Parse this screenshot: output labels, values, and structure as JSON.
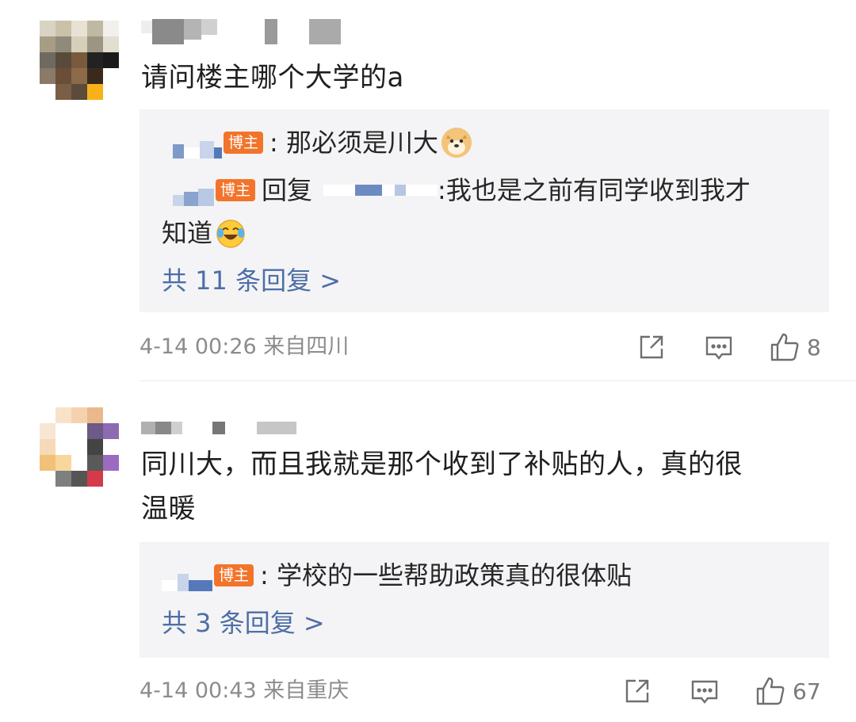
{
  "comments": [
    {
      "text": "请问楼主哪个大学的a",
      "replies": [
        {
          "badge": "博主",
          "text": ": 那必须是川大",
          "emoji": "doge-emoji"
        },
        {
          "badge": "博主",
          "prefix": "回复",
          "text_line1": ":我也是之前有同学收到我才",
          "text_line2": "知道",
          "emoji": "laugh-cry-emoji"
        }
      ],
      "more_replies": "共 11 条回复 >",
      "timestamp": "4-14 00:26 来自四川",
      "likes": "8"
    },
    {
      "text_line1": "同川大，而且我就是那个收到了补贴的人，真的很",
      "text_line2": "温暖",
      "replies": [
        {
          "badge": "博主",
          "text": ": 学校的一些帮助政策真的很体贴"
        }
      ],
      "more_replies": "共 3 条回复 >",
      "timestamp": "4-14 00:43 来自重庆",
      "likes": "67"
    }
  ],
  "icons": {
    "share": "share-icon",
    "comment": "comment-icon",
    "like": "thumbs-up-icon"
  },
  "colors": {
    "link": "#4e6ea6",
    "badge": "#f2742b",
    "reply_bg": "#f4f4f6",
    "meta": "#8c8c8c"
  }
}
